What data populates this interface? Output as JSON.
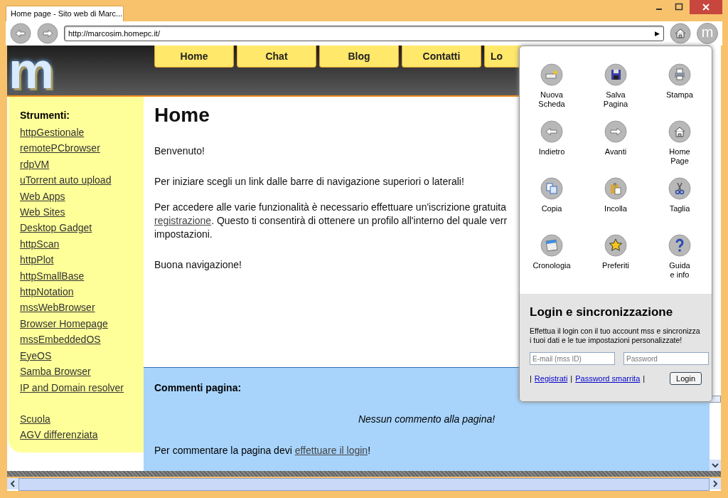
{
  "window": {
    "tab_title": "Home page - Sito web di Marc..."
  },
  "toolbar": {
    "address": "http://marcosim.homepc.it/",
    "go": "▶",
    "menu_button": "m"
  },
  "site": {
    "logo": "m",
    "nav": [
      {
        "label": "Home"
      },
      {
        "label": "Chat"
      },
      {
        "label": "Blog"
      },
      {
        "label": "Contatti"
      },
      {
        "label": "Lo"
      }
    ],
    "sidebar": {
      "heading": "Strumenti:",
      "links": [
        "httpGestionale",
        "remotePCbrowser",
        "rdpVM",
        "uTorrent auto upload",
        "Web Apps",
        "Web Sites",
        "Desktop Gadget",
        "httpScan",
        "httpPlot",
        "httpSmallBase",
        "httpNotation",
        "mssWebBrowser",
        "Browser Homepage",
        "mssEmbeddedOS",
        "EyeOS",
        "Samba Browser",
        "IP and Domain resolver"
      ],
      "extra_links": [
        "Scuola",
        "AGV differenziata"
      ]
    },
    "content": {
      "title": "Home",
      "welcome": "Benvenuto!",
      "intro": "Per iniziare scegli un link dalle barre di navigazione superiori o laterali!",
      "access_line_1": "Per accedere alle varie funzionalità è necessario effettuare un'iscrizione gratuita",
      "access_link": "registrazione",
      "access_line_2": ". Questo ti consentirà di ottenere un profilo all'interno del quale verr",
      "access_line_3": "impostazioni.",
      "closing": "Buona navigazione!"
    },
    "comments": {
      "heading": "Commenti pagina:",
      "empty": "Nessun commento alla pagina!",
      "prompt": "Per commentare la pagina devi ",
      "prompt_link": "effettuare il login",
      "prompt_end": "!"
    }
  },
  "menu": {
    "items": [
      {
        "label": "Nuova\nScheda"
      },
      {
        "label": "Salva\nPagina"
      },
      {
        "label": "Stampa"
      },
      {
        "label": "Indietro"
      },
      {
        "label": "Avanti"
      },
      {
        "label": "Home\nPage"
      },
      {
        "label": "Copia"
      },
      {
        "label": "Incolla"
      },
      {
        "label": "Taglia"
      },
      {
        "label": "Cronologia"
      },
      {
        "label": "Preferiti"
      },
      {
        "label": "Guida\ne info"
      }
    ],
    "login": {
      "title": "Login e sincronizzazione",
      "text": "Effettua il login con il tuo account mss e sincronizza i tuoi dati e le tue impostazioni personalizzate!",
      "email_placeholder": "E-mail (mss ID)",
      "password_placeholder": "Password",
      "sep": "|",
      "register": "Registrati",
      "lost_password": "Password smarrita",
      "button": "Login"
    }
  }
}
